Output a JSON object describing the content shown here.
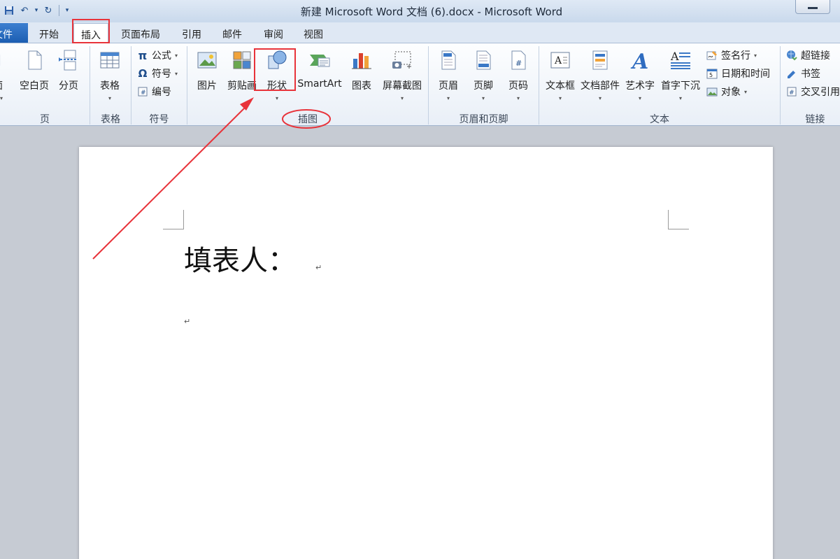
{
  "window": {
    "title": "新建 Microsoft Word 文档 (6).docx - Microsoft Word",
    "qat": [
      {
        "name": "save-icon",
        "glyph": "💾"
      },
      {
        "name": "undo-icon",
        "glyph": "↶"
      },
      {
        "name": "undo-dropdown-icon",
        "glyph": "▾"
      },
      {
        "name": "redo-icon",
        "glyph": "↻"
      },
      {
        "name": "customize-qat-icon",
        "glyph": "▾"
      }
    ]
  },
  "tabs": {
    "file": "文件",
    "home": "开始",
    "insert": "插入",
    "layout": "页面布局",
    "references": "引用",
    "mailings": "邮件",
    "review": "审阅",
    "view": "视图"
  },
  "ribbon": {
    "pages": {
      "label": "页",
      "cover": "面",
      "blank": "空白页",
      "break": "分页"
    },
    "tables": {
      "label": "表格",
      "table": "表格"
    },
    "symbols": {
      "label": "符号",
      "equation": "公式",
      "symbol": "符号",
      "number": "编号"
    },
    "illustrations": {
      "label": "插图",
      "picture": "图片",
      "clipart": "剪贴画",
      "shapes": "形状",
      "smartart": "SmartArt",
      "chart": "图表",
      "screenshot": "屏幕截图"
    },
    "header_footer": {
      "label": "页眉和页脚",
      "header": "页眉",
      "footer": "页脚",
      "page_number": "页码"
    },
    "text": {
      "label": "文本",
      "textbox": "文本框",
      "quickparts": "文档部件",
      "wordart": "艺术字",
      "dropcap": "首字下沉",
      "signature": "签名行",
      "datetime": "日期和时间",
      "object": "对象"
    },
    "links": {
      "label": "链接",
      "hyperlink": "超链接",
      "bookmark": "书签",
      "crossref": "交叉引用"
    }
  },
  "document": {
    "line1": "填表人：",
    "para_mark": "↵"
  },
  "colors": {
    "annotation_red": "#e8333a",
    "file_tab": "#2a6dc2"
  }
}
